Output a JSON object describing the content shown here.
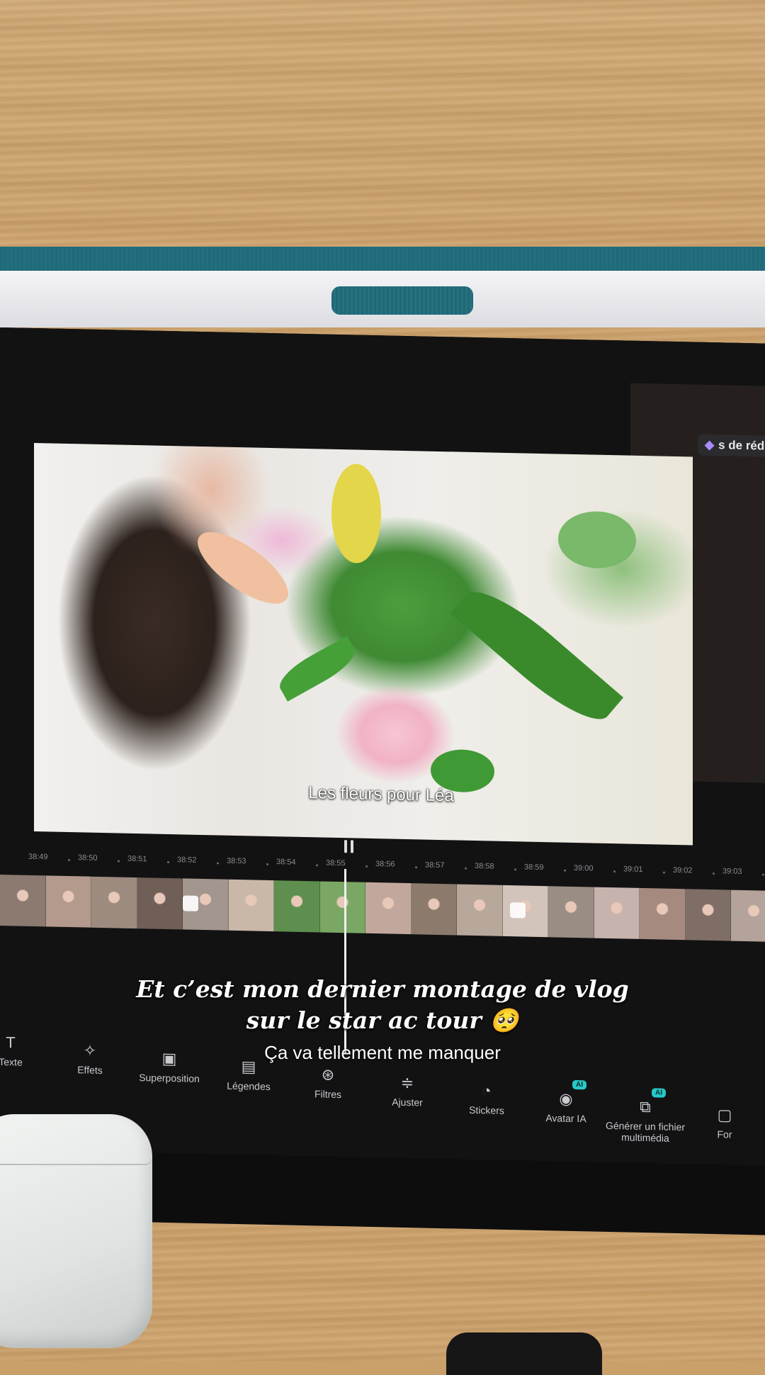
{
  "editor": {
    "top_pill_text": "s de rédu",
    "preview_subtitle": "Les fleurs pour Léa",
    "timeline_ticks": [
      "38:49",
      "38:50",
      "38:51",
      "38:52",
      "38:53",
      "38:54",
      "38:55",
      "38:56",
      "38:57",
      "38:58",
      "38:59",
      "39:00",
      "39:01",
      "39:02",
      "39:03"
    ],
    "toolbar": [
      {
        "label": "Texte",
        "icon": "text-icon",
        "ai": false
      },
      {
        "label": "Effets",
        "icon": "effects-icon",
        "ai": false
      },
      {
        "label": "Superposition",
        "icon": "overlay-icon",
        "ai": false
      },
      {
        "label": "Légendes",
        "icon": "captions-icon",
        "ai": false
      },
      {
        "label": "Filtres",
        "icon": "filters-icon",
        "ai": false
      },
      {
        "label": "Ajuster",
        "icon": "adjust-icon",
        "ai": false
      },
      {
        "label": "Stickers",
        "icon": "stickers-icon",
        "ai": false
      },
      {
        "label": "Avatar IA",
        "icon": "avatar-icon",
        "ai": true
      },
      {
        "label": "Générer un fichier multimédia",
        "icon": "generate-media-icon",
        "ai": true
      },
      {
        "label": "For",
        "icon": "format-icon",
        "ai": false
      }
    ],
    "ai_badge": "AI"
  },
  "overlay": {
    "caption_main": "Et c’est mon dernier montage de vlog sur le star ac tour 🥺",
    "caption_sub": "Ça va tellement me manquer"
  },
  "colors": {
    "accent_teal": "#26c8c8",
    "case_teal": "#1f6a78",
    "gem": "#a98bff"
  }
}
